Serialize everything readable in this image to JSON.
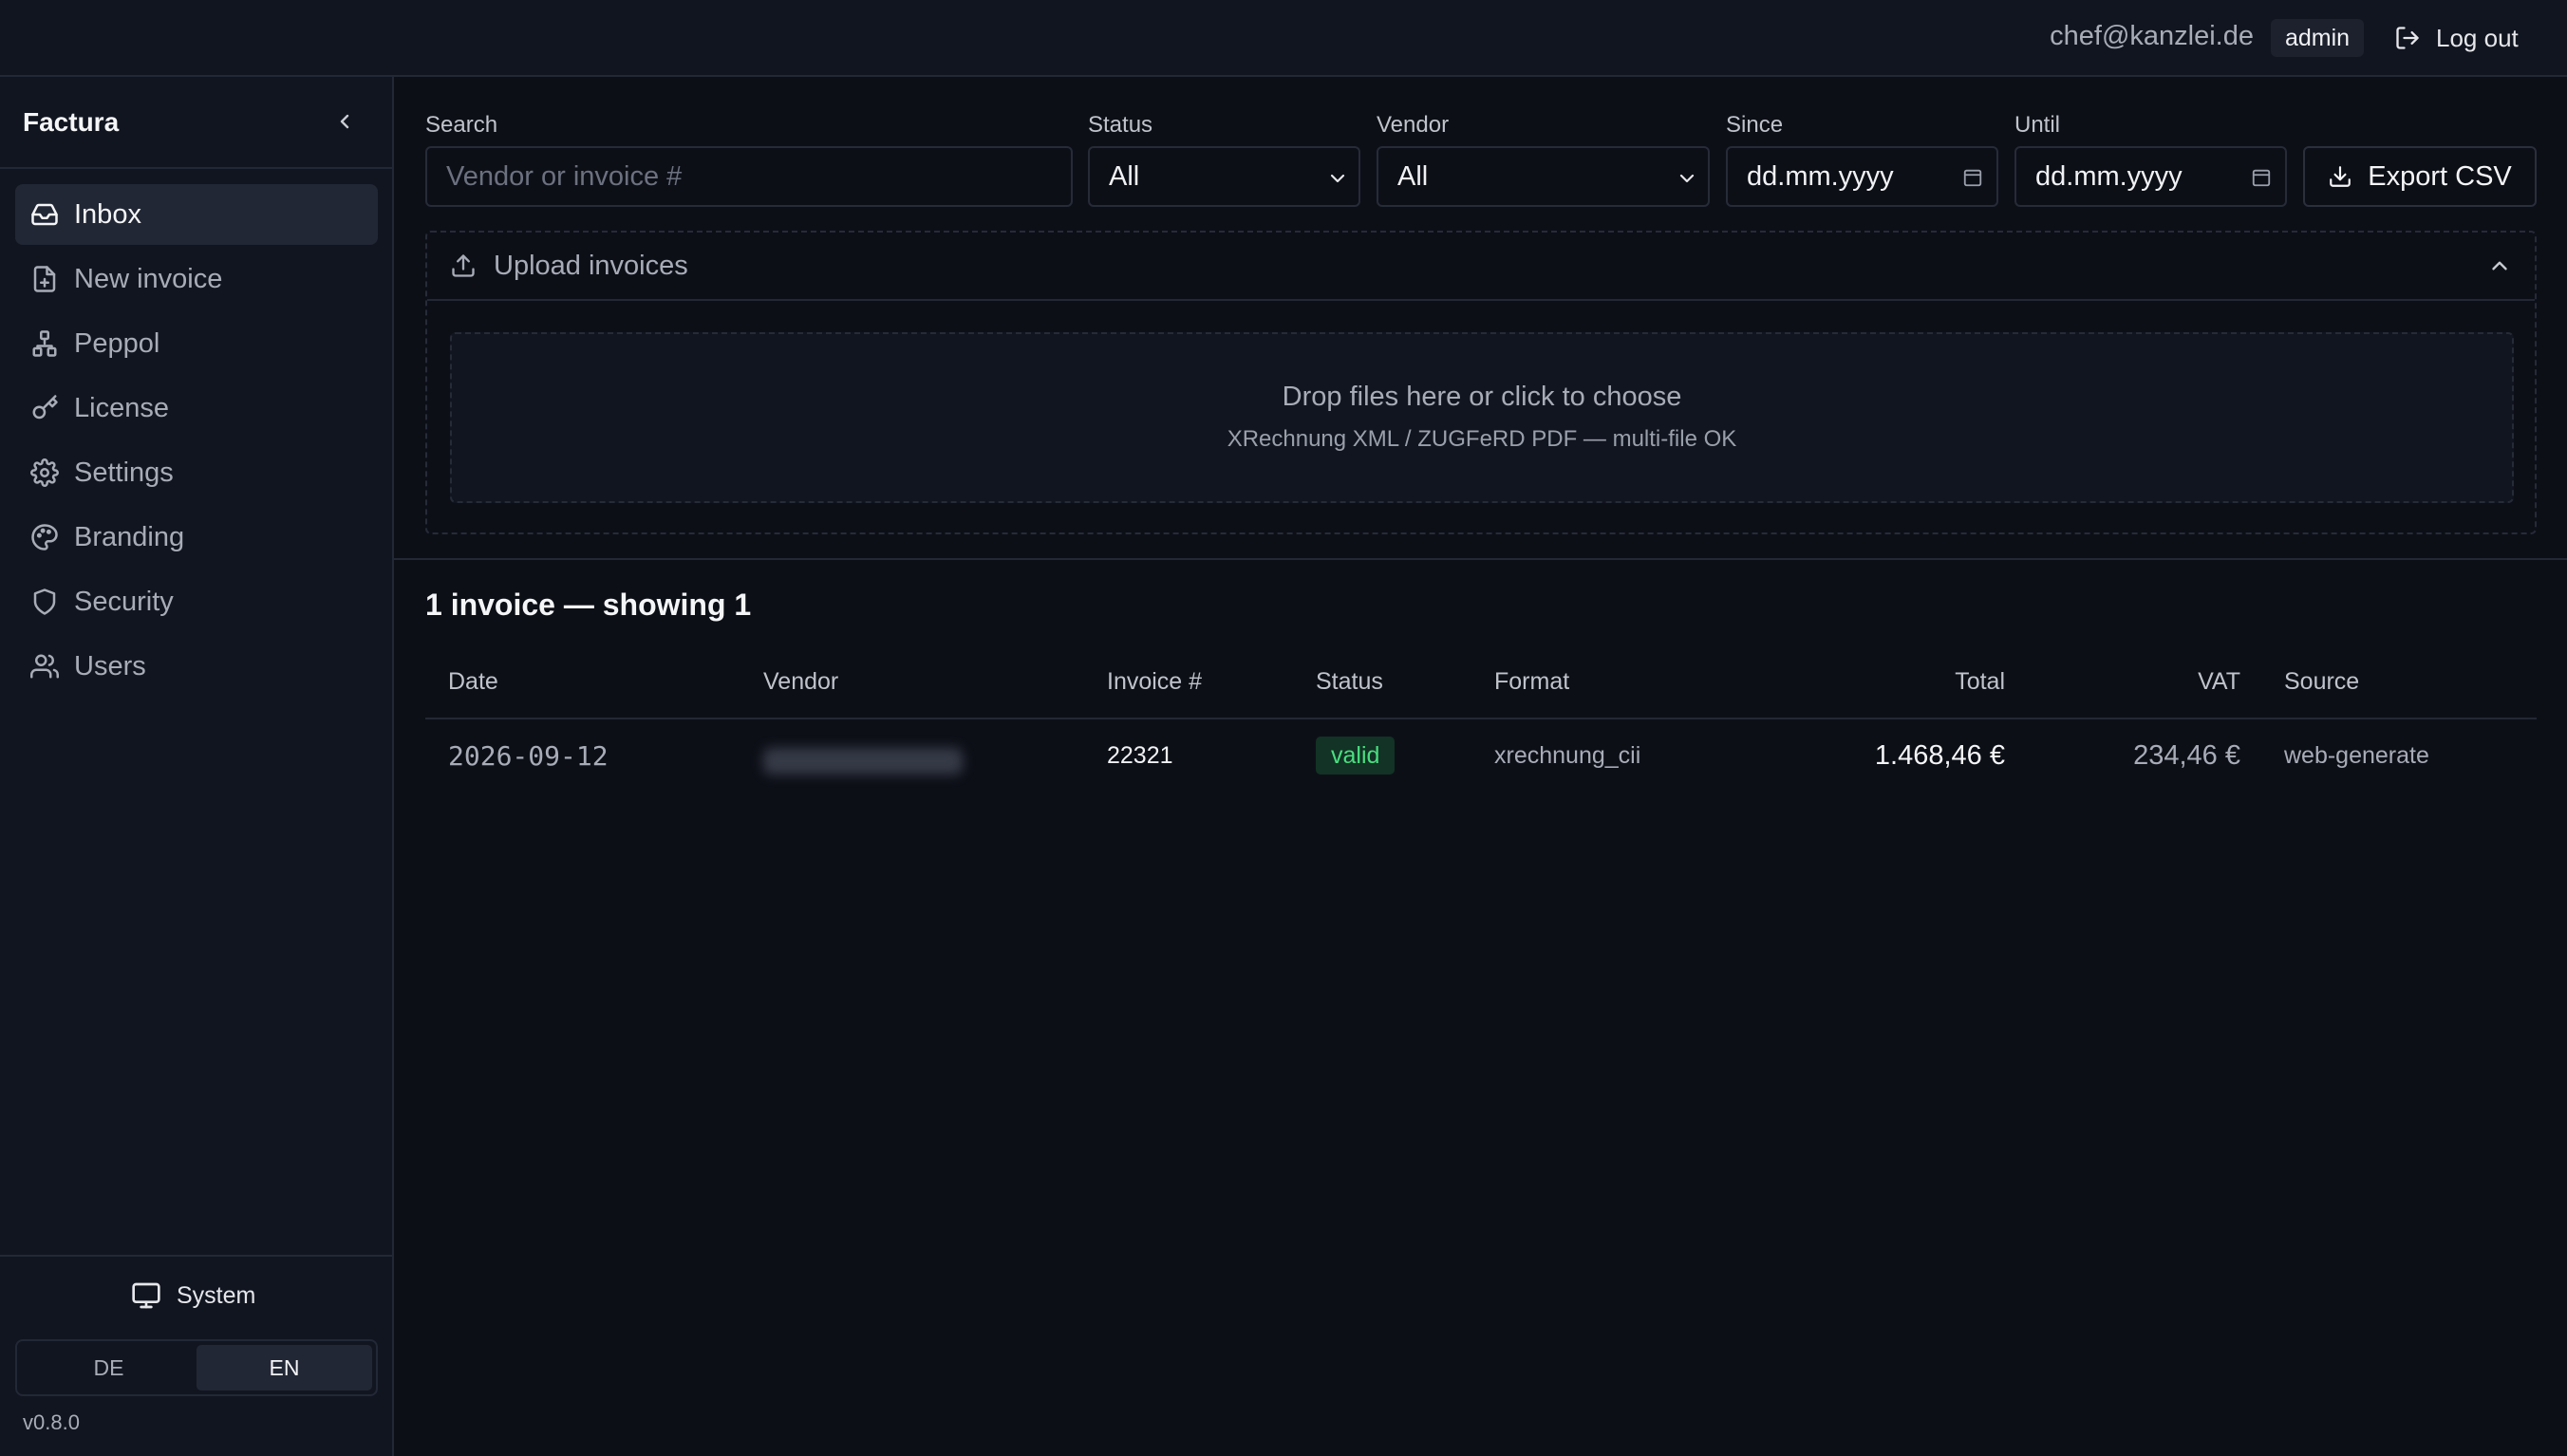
{
  "header": {
    "user_email": "chef@kanzlei.de",
    "role": "admin",
    "logout_label": "Log out"
  },
  "sidebar": {
    "brand": "Factura",
    "items": [
      {
        "label": "Inbox",
        "icon": "inbox-icon",
        "active": true
      },
      {
        "label": "New invoice",
        "icon": "file-plus-icon"
      },
      {
        "label": "Peppol",
        "icon": "network-icon"
      },
      {
        "label": "License",
        "icon": "key-icon"
      },
      {
        "label": "Settings",
        "icon": "gear-icon"
      },
      {
        "label": "Branding",
        "icon": "palette-icon"
      },
      {
        "label": "Security",
        "icon": "shield-icon"
      },
      {
        "label": "Users",
        "icon": "users-icon"
      }
    ],
    "theme_label": "System",
    "languages": [
      "DE",
      "EN"
    ],
    "active_language": "EN",
    "version": "v0.8.0"
  },
  "filters": {
    "search_label": "Search",
    "search_placeholder": "Vendor or invoice #",
    "status_label": "Status",
    "status_value": "All",
    "vendor_label": "Vendor",
    "vendor_value": "All",
    "since_label": "Since",
    "since_placeholder": "dd.mm.yyyy",
    "until_label": "Until",
    "until_placeholder": "dd.mm.yyyy",
    "export_label": "Export CSV"
  },
  "upload": {
    "title": "Upload invoices",
    "drop_title": "Drop files here or click to choose",
    "drop_subtitle": "XRechnung XML / ZUGFeRD PDF — multi-file OK"
  },
  "results": {
    "count_text": "1 invoice — showing 1",
    "columns": [
      "Date",
      "Vendor",
      "Invoice #",
      "Status",
      "Format",
      "Total",
      "VAT",
      "Source"
    ],
    "rows": [
      {
        "date": "2026-09-12",
        "vendor": "",
        "invoice_no": "22321",
        "status": "valid",
        "format": "xrechnung_cii",
        "total": "1.468,46 €",
        "vat": "234,46 €",
        "source": "web-generate"
      }
    ]
  },
  "colors": {
    "background": "#0d0f17",
    "panel": "#111520",
    "border": "#232836",
    "accent_valid": "#4ade80"
  }
}
